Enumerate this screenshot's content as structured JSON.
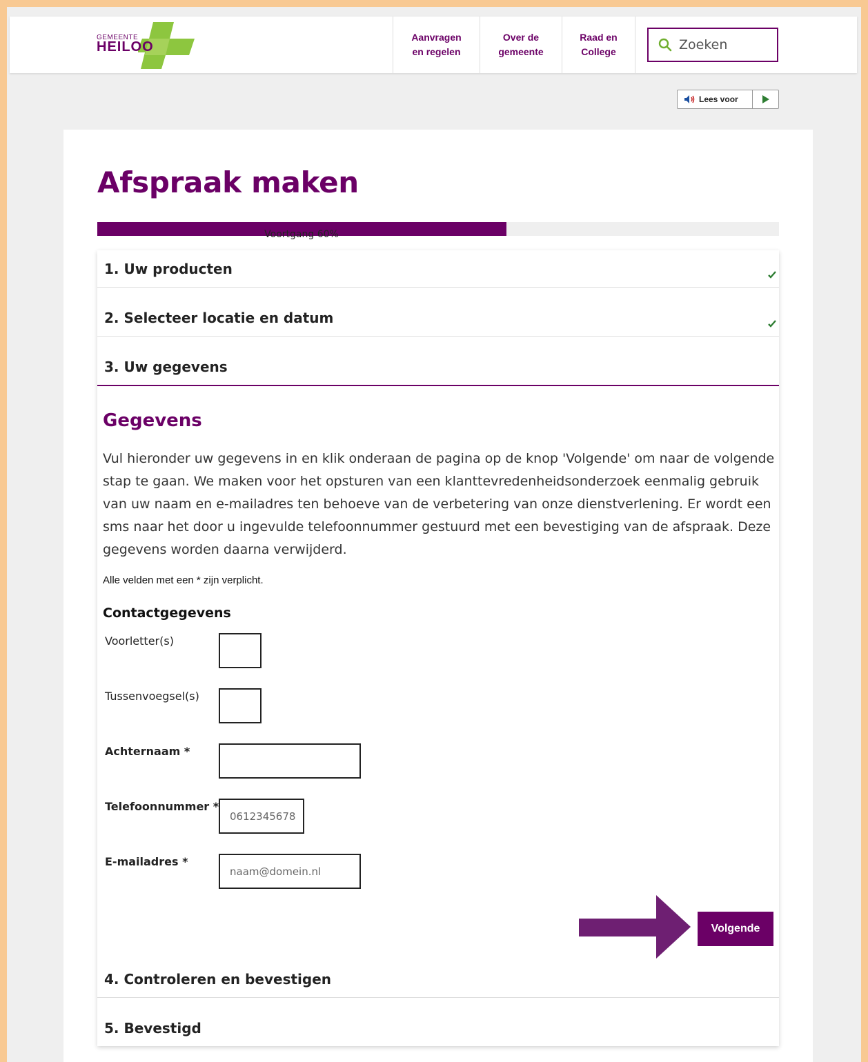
{
  "header": {
    "logo_small": "GEMEENTE",
    "logo_big": "HEILOO",
    "nav": [
      {
        "label": "Aanvragen\nen regelen"
      },
      {
        "label": "Over de\ngemeente"
      },
      {
        "label": "Raad en\nCollege"
      }
    ],
    "search_placeholder": "Zoeken"
  },
  "read_aloud": {
    "label": "Lees voor"
  },
  "page_title": "Afspraak maken",
  "progress": {
    "value_percent": 60,
    "label": "Voortgang 60%"
  },
  "steps": [
    {
      "label": "1. Uw producten",
      "completed": true
    },
    {
      "label": "2. Selecteer locatie en datum",
      "completed": true
    },
    {
      "label": "3. Uw gegevens",
      "active": true
    },
    {
      "label": "4. Controleren en bevestigen"
    },
    {
      "label": "5. Bevestigd"
    }
  ],
  "form": {
    "title": "Gegevens",
    "intro": "Vul hieronder uw gegevens in en klik onderaan de pagina op de knop 'Volgende' om naar de volgende stap te gaan. We maken voor het opsturen van een klanttevredenheidsonderzoek eenmalig gebruik van uw naam en e-mailadres ten behoeve van de verbetering van onze dienstverlening. Er wordt een sms naar het door u ingevulde telefoonnummer gestuurd met een bevestiging van de afspraak. Deze gegevens worden daarna verwijderd.",
    "required_note": "Alle velden met een * zijn verplicht.",
    "section_title": "Contactgegevens",
    "fields": [
      {
        "label": "Voorletter(s)",
        "value": "",
        "placeholder": ""
      },
      {
        "label": "Tussenvoegsel(s)",
        "value": "",
        "placeholder": ""
      },
      {
        "label": "Achternaam *",
        "value": "",
        "placeholder": ""
      },
      {
        "label": "Telefoonnummer *",
        "value": "",
        "placeholder": "0612345678"
      },
      {
        "label": "E-mailadres *",
        "value": "",
        "placeholder": "naam@domein.nl"
      }
    ],
    "next_button": "Volgende"
  },
  "colors": {
    "brand_purple": "#6b0066",
    "brand_green": "#8dc63f",
    "check_green": "#2e7d32",
    "frame_orange": "#f8c993"
  },
  "icons": [
    "search-icon",
    "speaker-icon",
    "play-icon",
    "check-icon",
    "arrow-right-icon"
  ]
}
